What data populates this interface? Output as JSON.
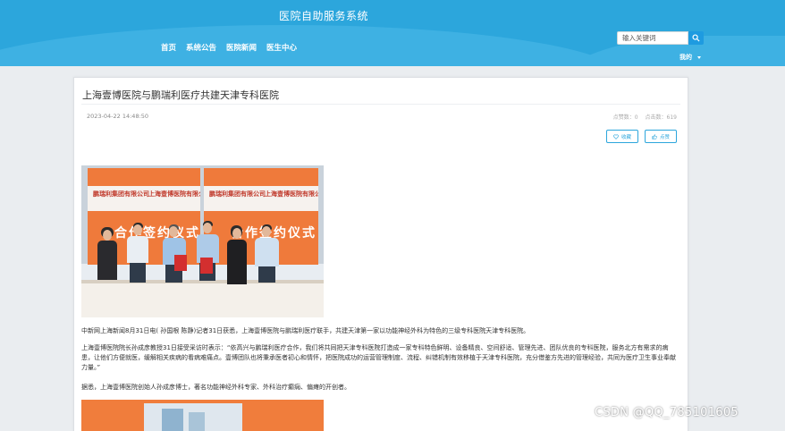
{
  "header": {
    "site_title": "医院自助服务系统",
    "nav": [
      "首页",
      "系统公告",
      "医院新闻",
      "医生中心"
    ],
    "search_placeholder": "输入关键词",
    "account_label": "我的"
  },
  "article": {
    "title": "上海壹博医院与鹏瑞利医疗共建天津专科医院",
    "date": "2023-04-22 14:48:50",
    "likes_label": "点赞数：0",
    "clicks_label": "点击数：619",
    "fav_button": "收藏",
    "like_button": "点赞",
    "photo_banner_left": "鹏瑞利集团有限公司",
    "photo_banner_right": "上海壹博医院有限公司",
    "photo_big_text": "合作签约仪式",
    "paragraphs": [
      "中新网上海新闻8月31日电( 孙国根 陈静)记者31日获悉，上海壹博医院与鹏瑞利医疗联手，共建天津第一家以功能神经外科为特色的三级专科医院天津专科医院。",
      "上海壹博医院院长孙成彦教授31日接受采访时表示：“依高兴与鹏瑞利医疗合作，我们将共同把天津专科医院打造成一家专科特色鲜明、设备精良、空间舒适、管理先进、团队优良的专科医院，服务北方有需求的病患，让他们方便就医，缓解相关疾病的看病难痛点。壹博团队也将秉承医者初心和情怀，把医院成功的运营管理制度、流程、纠错机制有效移植于天津专科医院，充分借鉴方先进的管理经验，共同为医疗卫生事业奉献力量。”",
      "据悉，上海壹博医院创始人孙成彦博士，著名功能神经外科专家、外科治疗癫痫、偏瘫的开创者。"
    ]
  },
  "watermark": "CSDN @QQ_785101605",
  "colors": {
    "header_bg": "#2ca6dc",
    "accent": "#1e9be0"
  }
}
